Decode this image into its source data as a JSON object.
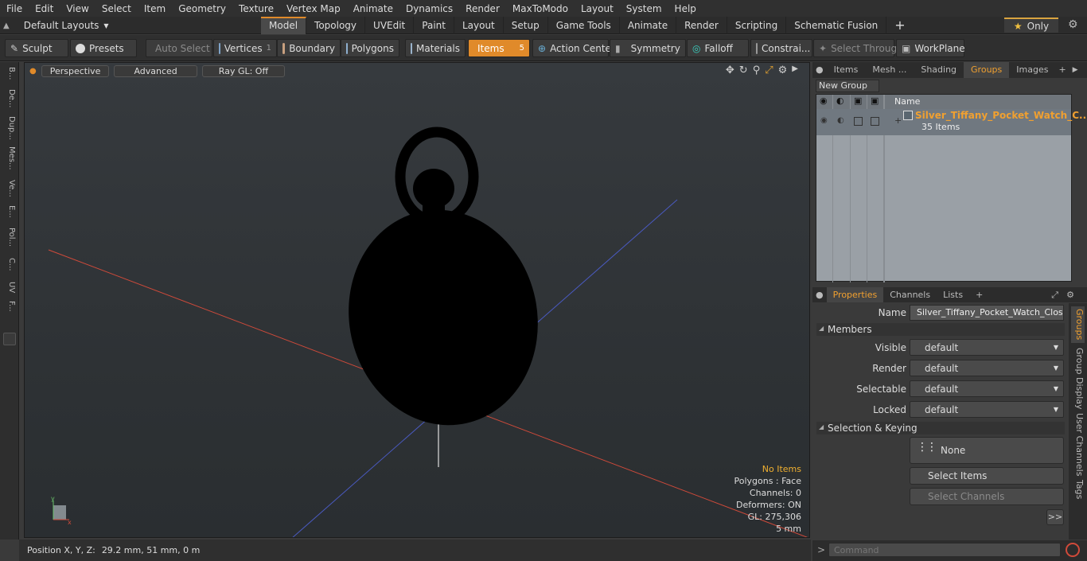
{
  "menubar": [
    "File",
    "Edit",
    "View",
    "Select",
    "Item",
    "Geometry",
    "Texture",
    "Vertex Map",
    "Animate",
    "Dynamics",
    "Render",
    "MaxToModo",
    "Layout",
    "System",
    "Help"
  ],
  "layouts": {
    "label": "Default Layouts"
  },
  "tabs": [
    "Model",
    "Topology",
    "UVEdit",
    "Paint",
    "Layout",
    "Setup",
    "Game Tools",
    "Animate",
    "Render",
    "Scripting",
    "Schematic Fusion"
  ],
  "only_label": "Only",
  "toolbar": {
    "sculpt": "Sculpt",
    "presets": "Presets",
    "auto_select": "Auto Select",
    "vertices": "Vertices",
    "vertices_count": "1",
    "boundary": "Boundary",
    "polygons": "Polygons",
    "materials": "Materials",
    "items": "Items",
    "items_count": "5",
    "action_center": "Action Center",
    "symmetry": "Symmetry",
    "falloff": "Falloff",
    "constraints": "Constrai...",
    "select_through": "Select Through",
    "workplane": "WorkPlane"
  },
  "leftstrip": [
    "B...",
    "De...",
    "Dup...",
    "Mes...",
    "Ve...",
    "E...",
    "Pol...",
    "C...",
    "UV",
    "F..."
  ],
  "viewport": {
    "perspective": "Perspective",
    "advanced": "Advanced",
    "raygl": "Ray GL: Off",
    "info": {
      "items": "No Items",
      "polygons": "Polygons : Face",
      "channels": "Channels: 0",
      "deformers": "Deformers: ON",
      "gl": "GL: 275,306",
      "scale": "5 mm"
    }
  },
  "status": {
    "label": "Position X, Y, Z:",
    "value": "29.2 mm, 51 mm, 0 m"
  },
  "right_tabs": [
    "Items",
    "Mesh ...",
    "Shading",
    "Groups",
    "Images"
  ],
  "groups": {
    "new_group": "New Group",
    "name_header": "Name",
    "row_name": "Silver_Tiffany_Pocket_Watch_C...",
    "row_count": "35 Items"
  },
  "prop_tabs": [
    "Properties",
    "Channels",
    "Lists"
  ],
  "props": {
    "name_label": "Name",
    "name_value": "Silver_Tiffany_Pocket_Watch_Closed",
    "members": "Members",
    "visible_label": "Visible",
    "visible": "default",
    "render_label": "Render",
    "render": "default",
    "selectable_label": "Selectable",
    "selectable": "default",
    "locked_label": "Locked",
    "locked": "default",
    "sel_keying": "Selection & Keying",
    "none": "None",
    "select_items": "Select Items",
    "select_channels": "Select Channels",
    "more": ">>"
  },
  "vtabs": [
    "Groups",
    "Group Display",
    "User Channels",
    "Tags"
  ],
  "command_placeholder": "Command",
  "colors": {
    "accent": "#e08a2a",
    "highlight": "#f0b030"
  }
}
